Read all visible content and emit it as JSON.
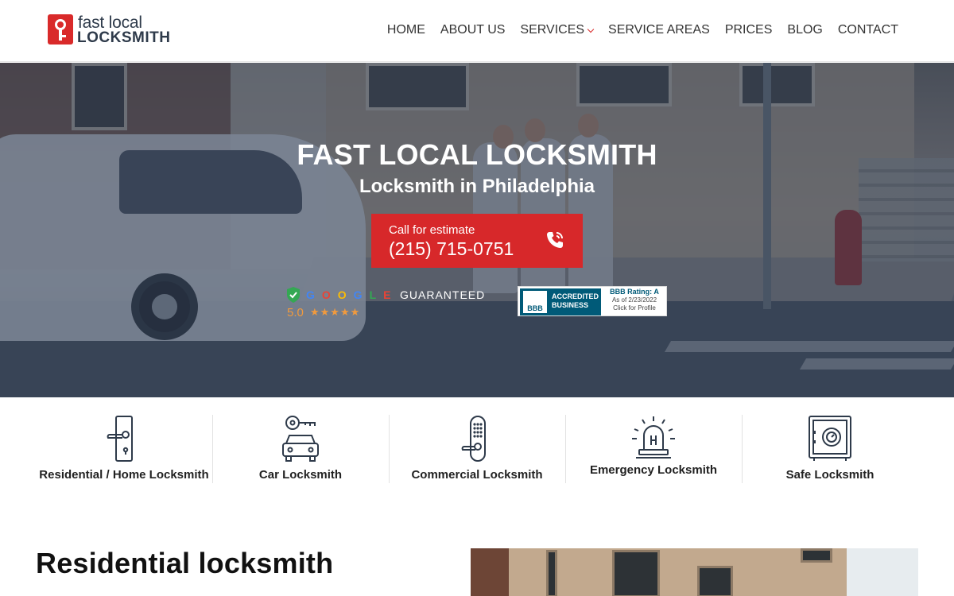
{
  "header": {
    "logo_line1": "fast local",
    "logo_line2": "LOCKSMITH",
    "nav": [
      {
        "label": "HOME"
      },
      {
        "label": "ABOUT US"
      },
      {
        "label": "SERVICES"
      },
      {
        "label": "SERVICE AREAS"
      },
      {
        "label": "PRICES"
      },
      {
        "label": "BLOG"
      },
      {
        "label": "CONTACT"
      }
    ]
  },
  "hero": {
    "title": "FAST LOCAL LOCKSMITH",
    "subtitle": "Locksmith in Philadelphia",
    "cta_label": "Call for estimate",
    "cta_phone": "(215) 715-0751",
    "google_letters": "GOOGLE",
    "google_guaranteed": "GUARANTEED",
    "google_rating": "5.0",
    "google_stars": "★★★★★",
    "bbb_logo": "BBB",
    "bbb_line1": "ACCREDITED",
    "bbb_line2": "BUSINESS",
    "bbb_rating": "BBB Rating: A",
    "bbb_date": "As of 2/23/2022",
    "bbb_link": "Click for Profile"
  },
  "services": [
    {
      "label": "Residential / Home Locksmith",
      "icon": "door-handle-icon"
    },
    {
      "label": "Car Locksmith",
      "icon": "car-key-icon"
    },
    {
      "label": "Commercial Locksmith",
      "icon": "keypad-lock-icon"
    },
    {
      "label": "Emergency Locksmith",
      "icon": "siren-icon"
    },
    {
      "label": "Safe Locksmith",
      "icon": "safe-icon"
    }
  ],
  "section": {
    "title": "Residential locksmith"
  },
  "colors": {
    "brand_red": "#d7282a",
    "text_dark": "#222222",
    "logo_navy": "#2e3a4a",
    "bbb_blue": "#005a78",
    "star_orange": "#f09a3e"
  }
}
